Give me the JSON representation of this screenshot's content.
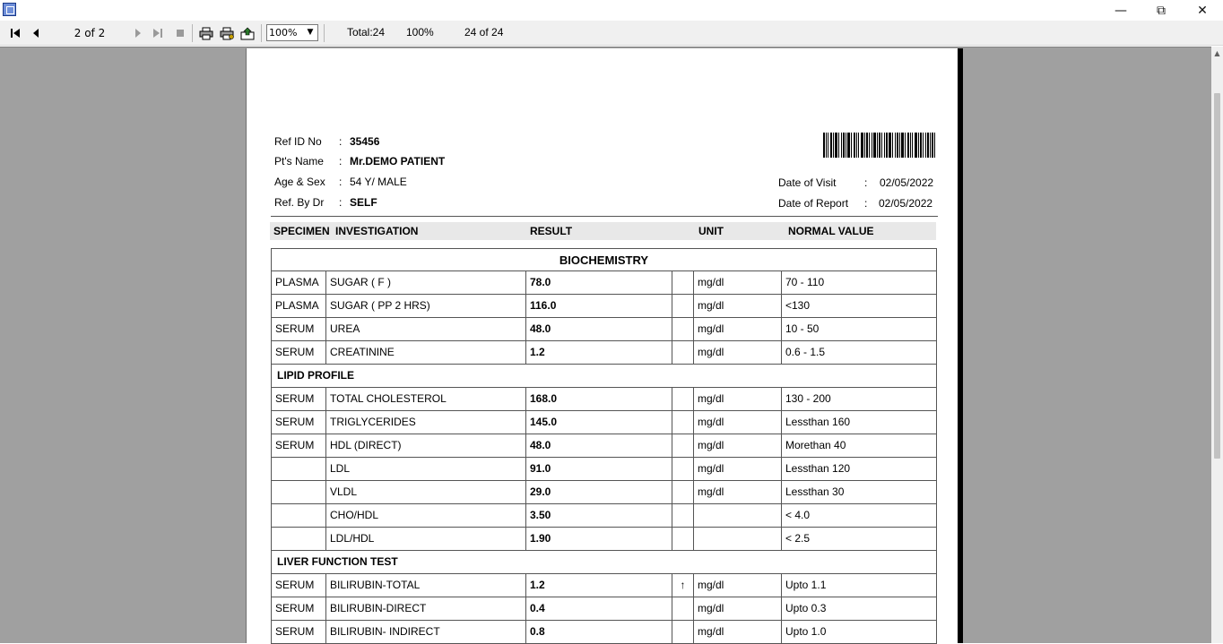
{
  "toolbar": {
    "page_indicator": "2 of 2",
    "zoom_value": "100%",
    "total": "Total:24",
    "zoom_percent": "100%",
    "records": "24 of 24"
  },
  "report": {
    "ref_id_label": "Ref ID No",
    "ref_id_value": "35456",
    "name_label": "Pt's Name",
    "name_value": "Mr.DEMO PATIENT",
    "age_label": "Age & Sex",
    "age_value": "54 Y/ MALE",
    "refby_label": "Ref. By Dr",
    "refby_value": "SELF",
    "visit_label": "Date of Visit",
    "visit_value": "02/05/2022",
    "report_label": "Date of Report",
    "report_value": "02/05/2022",
    "colon": ":",
    "headers": {
      "specimen": "SPECIMEN",
      "investigation": "INVESTIGATION",
      "result": "RESULT",
      "unit": "UNIT",
      "normal": "NORMAL VALUE"
    },
    "section": "BIOCHEMISTRY",
    "rows": [
      {
        "specimen": "PLASMA",
        "test": "SUGAR ( F )",
        "result": "78.0",
        "flag": "",
        "unit": "mg/dl",
        "normal": "70 - 110"
      },
      {
        "specimen": "PLASMA",
        "test": "SUGAR ( PP 2 HRS)",
        "result": "116.0",
        "flag": "",
        "unit": "mg/dl",
        "normal": "<130"
      },
      {
        "specimen": "SERUM",
        "test": "UREA",
        "result": "48.0",
        "flag": "",
        "unit": "mg/dl",
        "normal": "10 - 50"
      },
      {
        "specimen": "SERUM",
        "test": "CREATININE",
        "result": "1.2",
        "flag": "",
        "unit": "mg/dl",
        "normal": "0.6 - 1.5"
      }
    ],
    "lipid_title": "LIPID PROFILE",
    "lipid_rows": [
      {
        "specimen": "SERUM",
        "test": "TOTAL CHOLESTEROL",
        "result": "168.0",
        "flag": "",
        "unit": "mg/dl",
        "normal": "130 - 200"
      },
      {
        "specimen": "SERUM",
        "test": "TRIGLYCERIDES",
        "result": "145.0",
        "flag": "",
        "unit": "mg/dl",
        "normal": "Lessthan 160"
      },
      {
        "specimen": "SERUM",
        "test": "HDL  (DIRECT)",
        "result": "48.0",
        "flag": "",
        "unit": "mg/dl",
        "normal": "Morethan 40"
      },
      {
        "specimen": "",
        "test": "LDL",
        "result": "91.0",
        "flag": "",
        "unit": "mg/dl",
        "normal": "Lessthan 120"
      },
      {
        "specimen": "",
        "test": "VLDL",
        "result": "29.0",
        "flag": "",
        "unit": "mg/dl",
        "normal": "Lessthan 30"
      },
      {
        "specimen": "",
        "test": "CHO/HDL",
        "result": "3.50",
        "flag": "",
        "unit": "",
        "normal": "< 4.0"
      },
      {
        "specimen": "",
        "test": "LDL/HDL",
        "result": "1.90",
        "flag": "",
        "unit": "",
        "normal": "< 2.5"
      }
    ],
    "liver_title": "LIVER FUNCTION TEST",
    "liver_rows": [
      {
        "specimen": "SERUM",
        "test": "BILIRUBIN-TOTAL",
        "result": "1.2",
        "flag": "↑",
        "unit": "mg/dl",
        "normal": "Upto 1.1"
      },
      {
        "specimen": "SERUM",
        "test": "BILIRUBIN-DIRECT",
        "result": "0.4",
        "flag": "",
        "unit": "mg/dl",
        "normal": "Upto 0.3"
      },
      {
        "specimen": "SERUM",
        "test": "BILIRUBIN- INDIRECT",
        "result": "0.8",
        "flag": "",
        "unit": "mg/dl",
        "normal": "Upto 1.0"
      }
    ]
  }
}
